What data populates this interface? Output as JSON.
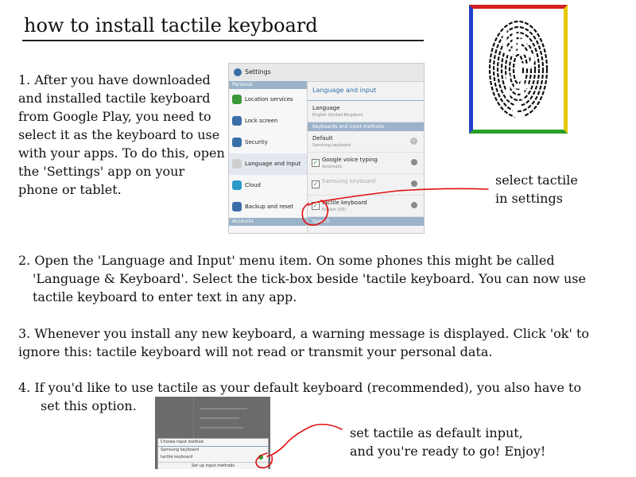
{
  "title": "how to install tactile keyboard",
  "step1": {
    "text": "1. After you have downloaded and installed tactile keyboard from Google Play, you need to select it as the keyboard to use with your apps. To do this, open the 'Settings' app on your phone or tablet."
  },
  "step2": {
    "line1": "2. Open the 'Language and Input' menu item. On some phones this might be called",
    "line2": "'Language & Keyboard'. Select the tick-box beside 'tactile keyboard. You can now use",
    "line3": "tactile keyboard to enter text in any app."
  },
  "step3": {
    "line1": "3. Whenever you install any new keyboard, a warning message is displayed. Click 'ok' to",
    "line2": "ignore this: tactile keyboard will not read or transmit your personal data."
  },
  "step4": {
    "line1": "4.  If you'd like to use tactile as your default keyboard (recommended), you also have to",
    "line2": "set this  option."
  },
  "annotations": {
    "settings_line1": "select tactile",
    "settings_line2": "in settings",
    "default_line1": "set tactile as default input,",
    "default_line2": "and you're ready to go! Enjoy!"
  },
  "settings_screenshot": {
    "header": "Settings",
    "left_section": "Personal",
    "left_items": [
      {
        "label": "Location services",
        "icon": "location-icon",
        "color": "#3a9a3a"
      },
      {
        "label": "Lock screen",
        "icon": "lock-icon",
        "color": "#3a6ea8"
      },
      {
        "label": "Security",
        "icon": "security-icon",
        "color": "#3a6ea8"
      },
      {
        "label": "Language and input",
        "icon": "language-icon",
        "color": "#cfcfcf"
      },
      {
        "label": "Cloud",
        "icon": "cloud-icon",
        "color": "#2a9ac8"
      },
      {
        "label": "Backup and reset",
        "icon": "backup-icon",
        "color": "#3a6ea8"
      }
    ],
    "left_footer": "Accounts",
    "right_title": "Language and input",
    "language": {
      "label": "Language",
      "value": "English (United Kingdom)"
    },
    "right_section": "Keyboards and input methods",
    "default": {
      "label": "Default",
      "value": "Samsung keyboard"
    },
    "google_voice": {
      "label": "Google voice typing",
      "value": "Automatic"
    },
    "samsung": {
      "label": "Samsung keyboard"
    },
    "tactile": {
      "label": "tactile keyboard",
      "value": "English (US)"
    },
    "right_footer": "Speech"
  },
  "dialog_screenshot": {
    "title": "Choose input method",
    "row1": "Samsung keyboard",
    "row2": "tactile keyboard",
    "button": "Set up input methods"
  },
  "colors": {
    "accent_red": "#e01010",
    "logo_red": "#d42020",
    "logo_blue": "#2040c8",
    "logo_green": "#28a028",
    "logo_yellow": "#e6c800"
  }
}
